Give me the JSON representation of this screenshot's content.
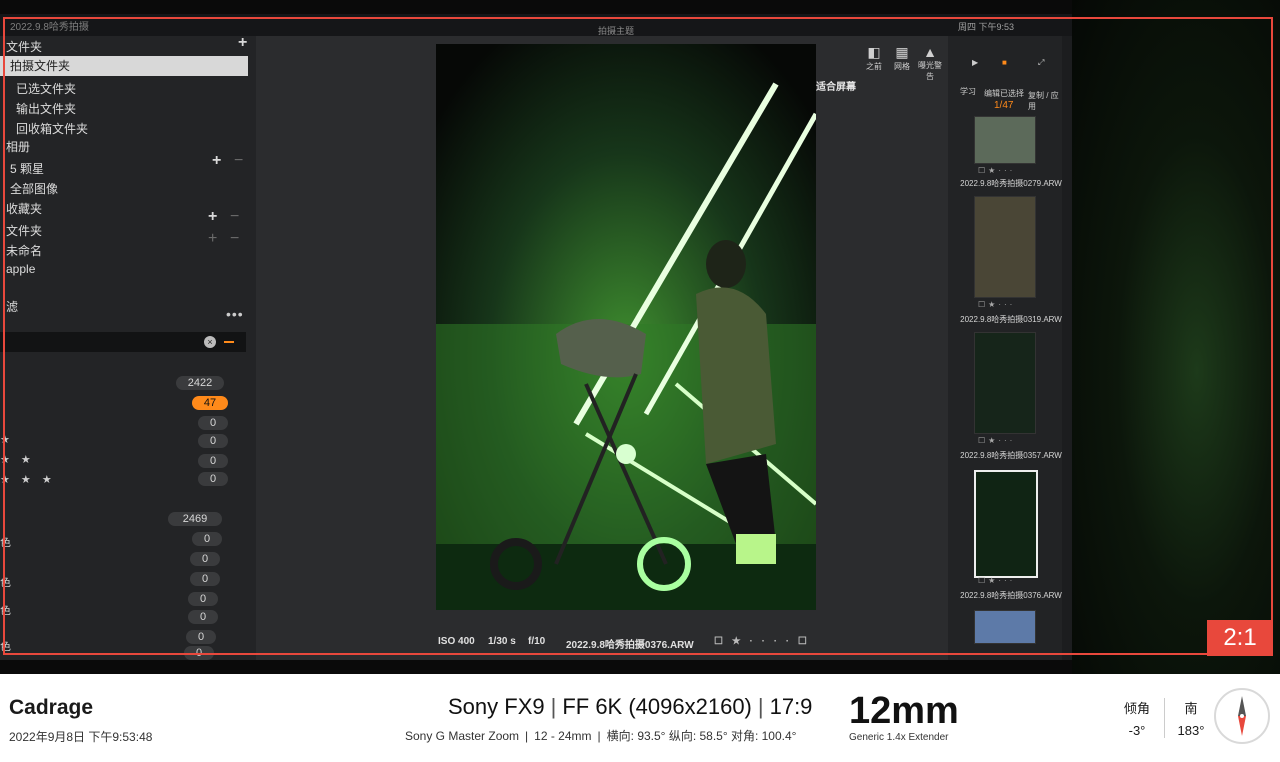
{
  "app": {
    "library_title": "2022.9.8哈秀拍摄",
    "document_title": "拍摄主题",
    "clock": "周四 下午9:53"
  },
  "sidebar": {
    "folders": [
      {
        "label": "文件夹"
      },
      {
        "label": "拍摄文件夹"
      },
      {
        "label": "已选文件夹"
      },
      {
        "label": "输出文件夹"
      },
      {
        "label": "回收箱文件夹"
      }
    ],
    "albums_header": "相册",
    "albums": [
      {
        "label": "5 颗星"
      },
      {
        "label": "全部图像"
      }
    ],
    "favorites_header": "收藏夹",
    "folders_header": "文件夹",
    "folder_items": [
      {
        "label": "未命名"
      },
      {
        "label": "apple"
      }
    ],
    "filters_label": "滤",
    "counts_top": [
      "2422",
      "47",
      "0",
      "0",
      "0",
      "0"
    ],
    "counts_bottom": [
      "2469",
      "0",
      "0",
      "0",
      "0",
      "0",
      "0",
      "0"
    ],
    "side_chars": [
      "色",
      "色",
      "色",
      "色"
    ]
  },
  "viewer": {
    "fit_label": "适合屏幕",
    "toolbar": [
      {
        "label": "之前",
        "icon": "before-after-icon"
      },
      {
        "label": "网格",
        "icon": "grid-icon"
      },
      {
        "label": "曝光警告",
        "icon": "exposure-warning-icon"
      }
    ],
    "info": {
      "iso": "ISO 400",
      "shutter": "1/30 s",
      "aperture": "f/10",
      "filename": "2022.9.8哈秀拍摄0376.ARW"
    }
  },
  "filmstrip": {
    "top_buttons": [
      {
        "label": "学习",
        "icon": "learn-icon"
      },
      {
        "label": "编辑已选择",
        "icon": "edit-selected-icon"
      },
      {
        "label": "复制 / 应用",
        "icon": "copy-apply-icon"
      }
    ],
    "counter": "1/47",
    "thumbnails": [
      {
        "name": "2022.9.8哈秀拍摄0279.ARW",
        "selected": false
      },
      {
        "name": "2022.9.8哈秀拍摄0319.ARW",
        "selected": false
      },
      {
        "name": "2022.9.8哈秀拍摄0357.ARW",
        "selected": false
      },
      {
        "name": "2022.9.8哈秀拍摄0376.ARW",
        "selected": true
      }
    ]
  },
  "overlay": {
    "aspect_ratio": "2:1",
    "frame_color": "#e8483c"
  },
  "footer": {
    "app_name": "Cadrage",
    "datetime": "2022年9月8日 下午9:53:48",
    "camera": "Sony FX9",
    "format": "FF 6K (4096x2160)",
    "aspect": "17:9",
    "lens": "Sony G Master Zoom",
    "lens_range": "12 - 24mm",
    "fov": "横向: 93.5°  纵向: 58.5°  对角: 100.4°",
    "focal_length": "12mm",
    "extender": "Generic 1.4x Extender",
    "tilt_label": "倾角",
    "tilt_value": "-3°",
    "heading_label": "南",
    "heading_value": "183°",
    "compass_icon": "compass-icon"
  }
}
